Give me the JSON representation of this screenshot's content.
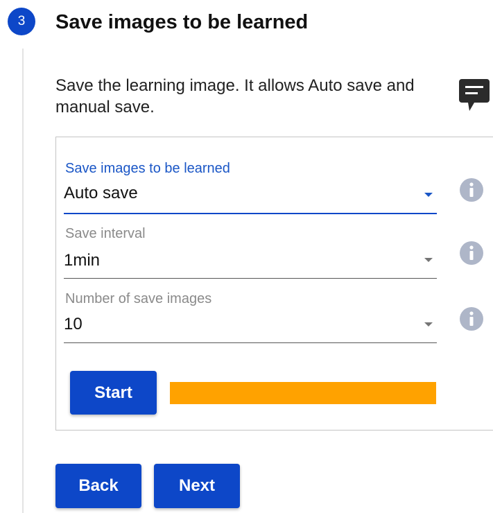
{
  "step": {
    "number": "3",
    "title": "Save images to be learned"
  },
  "description": "Save the learning image. It allows Auto save and manual save.",
  "icons": {
    "feedback": "comment-icon",
    "info": "info-icon",
    "dropdown": "chevron-down-icon"
  },
  "form": {
    "save_mode": {
      "label": "Save images to be learned",
      "value": "Auto save"
    },
    "save_interval": {
      "label": "Save interval",
      "value": "1min"
    },
    "save_count": {
      "label": "Number of save images",
      "value": "10"
    }
  },
  "start_button": "Start",
  "progress": {
    "fraction": 1.0,
    "color": "#ffa200"
  },
  "nav": {
    "back": "Back",
    "next": "Next"
  },
  "colors": {
    "primary": "#0d47c8",
    "active_label": "#1a56c6",
    "progress": "#ffa200"
  }
}
